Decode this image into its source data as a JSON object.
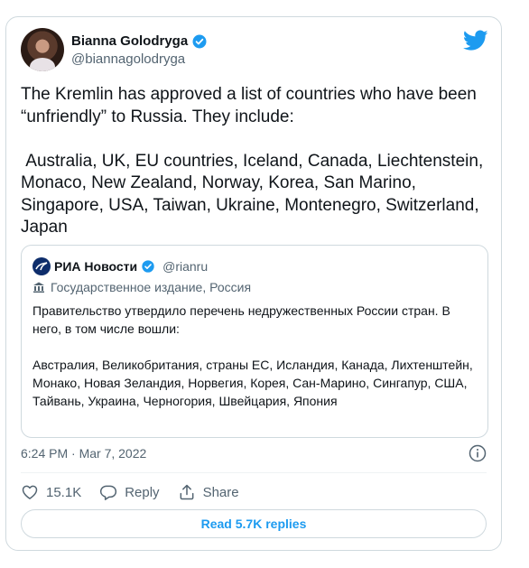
{
  "author": {
    "name": "Bianna Golodryga",
    "handle": "@biannagolodryga"
  },
  "tweet": {
    "text": "The Kremlin has approved a list of countries who have been “unfriendly” to Russia. They include:\n\n Australia, UK, EU countries, Iceland, Canada, Liechtenstein, Monaco, New Zealand, Norway, Korea, San Marino, Singapore, USA, Taiwan, Ukraine, Montenegro, Switzerland, Japan"
  },
  "quoted": {
    "name": "РИА Новости",
    "handle": "@rianru",
    "label": "Государственное издание, Россия",
    "text": "Правительство утвердило перечень недружественных России стран. В него, в том числе вошли:\n\nАвстралия, Великобритания, страны ЕС, Исландия, Канада, Лихтенштейн, Монако, Новая Зеландия, Норвегия, Корея, Сан-Марино, Сингапур, США, Тайвань, Украина, Черногория, Швейцария, Япония"
  },
  "meta": {
    "timestamp": "6:24 PM · Mar 7, 2022"
  },
  "actions": {
    "likes": "15.1K",
    "reply_label": "Reply",
    "share_label": "Share"
  },
  "footer": {
    "read_replies": "Read 5.7K replies"
  },
  "colors": {
    "accent": "#1d9bf0",
    "muted": "#536471",
    "border": "#cfd9de",
    "text": "#0f1419"
  },
  "icons": {
    "verified": "verified-badge-icon",
    "twitter": "twitter-bird-icon",
    "info": "info-icon",
    "like": "heart-icon",
    "reply": "speech-bubble-icon",
    "share": "share-arrow-icon",
    "label": "government-building-icon"
  }
}
